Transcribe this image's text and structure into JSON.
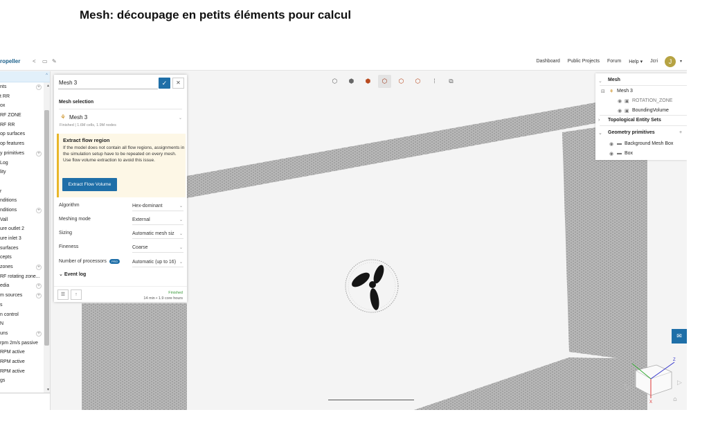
{
  "slide": {
    "title": "Mesh: découpage en petits éléments pour calcul"
  },
  "topbar": {
    "project_name": "ropeller",
    "icons": [
      "share-icon",
      "bookmark-icon",
      "edit-icon"
    ],
    "nav": [
      "Dashboard",
      "Public Projects",
      "Forum",
      "Help ▾",
      "Jcri"
    ],
    "avatar_letter": "J"
  },
  "tree": {
    "items": [
      {
        "label": "nts",
        "plus": true
      },
      {
        "label": "t RR",
        "plus": false
      },
      {
        "label": "ox",
        "plus": false
      },
      {
        "label": "RF ZONE",
        "plus": false
      },
      {
        "label": "RF RR",
        "plus": false
      },
      {
        "label": "op surfaces",
        "plus": false
      },
      {
        "label": "op features",
        "plus": false
      },
      {
        "label": "y primitives",
        "plus": true
      },
      {
        "label": "Log",
        "plus": false
      },
      {
        "label": "lity",
        "plus": false
      },
      {
        "label": "",
        "plus": false
      },
      {
        "label": "r",
        "plus": false
      },
      {
        "label": "nditions",
        "plus": false
      },
      {
        "label": "nditions",
        "plus": true
      },
      {
        "label": "Vall",
        "plus": false
      },
      {
        "label": "ure outlet 2",
        "plus": false
      },
      {
        "label": "ure inlet 3",
        "plus": false
      },
      {
        "label": "surfaces",
        "plus": false
      },
      {
        "label": "cepts",
        "plus": false
      },
      {
        "label": "zones",
        "plus": true
      },
      {
        "label": "RF rotating zone...",
        "plus": false
      },
      {
        "label": "edia",
        "plus": true
      },
      {
        "label": "m sources",
        "plus": true
      },
      {
        "label": "s",
        "plus": false
      },
      {
        "label": "n control",
        "plus": false
      },
      {
        "label": "N",
        "plus": false
      },
      {
        "label": "uns",
        "plus": true
      },
      {
        "label": "rpm 2m/s passive",
        "plus": false
      },
      {
        "label": "RPM active",
        "plus": false
      },
      {
        "label": "RPM active",
        "plus": false
      },
      {
        "label": "RPM active",
        "plus": false
      },
      {
        "label": "gs",
        "plus": false
      }
    ]
  },
  "mesh_panel": {
    "name": "Mesh 3",
    "selection_title": "Mesh selection",
    "selection_name": "Mesh 3",
    "selection_status": "Finished | 1.6M cells, 1.9M nodes",
    "extract": {
      "title": "Extract flow region",
      "text": "If the model does not contain all flow regions, assignments in the simulation setup have to be repeated on every mesh. Use flow volume extraction to avoid this issue.",
      "button": "Extract Flow Volume"
    },
    "fields": [
      {
        "label": "Algorithm",
        "value": "Hex-dominant"
      },
      {
        "label": "Meshing mode",
        "value": "External"
      },
      {
        "label": "Sizing",
        "value": "Automatic mesh siz"
      },
      {
        "label": "Fineness",
        "value": "Coarse"
      },
      {
        "label": "Number of processors",
        "value": "Automatic (up to 16)"
      }
    ],
    "pro_badge": "PRO",
    "event_log": "Event log",
    "status": "Finished",
    "time_info": "14 min • 1.9 core hours"
  },
  "toolbar": {
    "icons": [
      "cube-outline-icon",
      "cube-solid-icon",
      "cube-red-icon",
      "cube-wireframe-icon",
      "cube-edges-icon",
      "cube-surface-icon",
      "dots-icon",
      "layers-icon"
    ],
    "selected_index": 3
  },
  "scene_tree": {
    "mesh_header": "Mesh",
    "mesh_item": "Mesh 3",
    "children": [
      "ROTATION_ZONE",
      "BoundingVolume"
    ],
    "topo_header": "Topological Entity Sets",
    "geo_header": "Geometry primitives",
    "geo_items": [
      "Background Mesh Box",
      "Box"
    ]
  },
  "colors": {
    "accent": "#1f6fa8",
    "warning_bg": "#fdf7e6",
    "warning_border": "#e8b62a",
    "success": "#3b9a3b",
    "avatar": "#b6a343"
  }
}
